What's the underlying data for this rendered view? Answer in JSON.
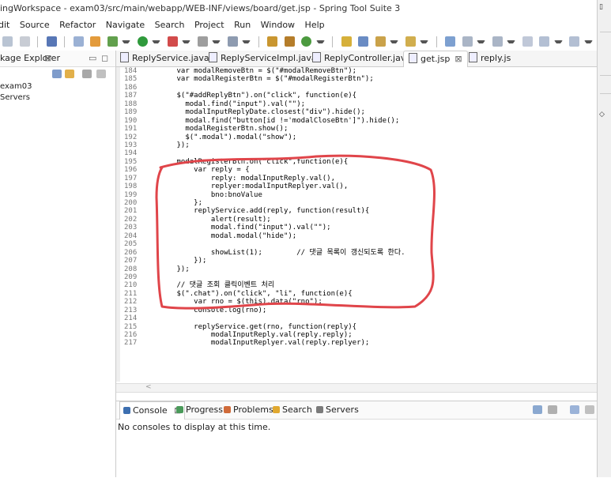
{
  "window": {
    "title": "ingWorkspace - exam03/src/main/webapp/WEB-INF/views/board/get.jsp - Spring Tool Suite 3"
  },
  "menu": [
    "dit",
    "Source",
    "Refactor",
    "Navigate",
    "Search",
    "Project",
    "Run",
    "Window",
    "Help"
  ],
  "package_explorer": {
    "title": "kage Explorer",
    "close_glyph": "⊠",
    "minimize_glyph": "▭",
    "maximize_glyph": "◻",
    "items": [
      "exam03",
      "Servers"
    ]
  },
  "editor": {
    "tabs": [
      {
        "label": "ReplyService.java",
        "active": false
      },
      {
        "label": "ReplyServiceImpl.java",
        "active": false
      },
      {
        "label": "ReplyController.java",
        "active": false
      },
      {
        "label": "get.jsp",
        "active": true,
        "close_glyph": "⊠"
      },
      {
        "label": "reply.js",
        "active": false
      }
    ],
    "lines": [
      {
        "n": "184",
        "t": "      var modalRemoveBtn = $(\"#modalRemoveBtn\");"
      },
      {
        "n": "185",
        "t": "      var modalRegisterBtn = $(\"#modalRegisterBtn\");"
      },
      {
        "n": "186",
        "t": ""
      },
      {
        "n": "187",
        "t": "      $(\"#addReplyBtn\").on(\"click\", function(e){"
      },
      {
        "n": "188",
        "t": "        modal.find(\"input\").val(\"\");"
      },
      {
        "n": "189",
        "t": "        modalInputReplyDate.closest(\"div\").hide();"
      },
      {
        "n": "190",
        "t": "        modal.find(\"button[id !='modalCloseBtn']\").hide();"
      },
      {
        "n": "191",
        "t": "        modalRegisterBtn.show();"
      },
      {
        "n": "192",
        "t": "        $(\".modal\").modal(\"show\");"
      },
      {
        "n": "193",
        "t": "      });"
      },
      {
        "n": "194",
        "t": ""
      },
      {
        "n": "195",
        "t": "      modalRegisterBtn.on(\"click\",function(e){"
      },
      {
        "n": "196",
        "t": "          var reply = {"
      },
      {
        "n": "197",
        "t": "              reply: modalInputReply.val(),"
      },
      {
        "n": "198",
        "t": "              replyer:modalInputReplyer.val(),"
      },
      {
        "n": "199",
        "t": "              bno:bnoValue"
      },
      {
        "n": "200",
        "t": "          };"
      },
      {
        "n": "201",
        "t": "          replyService.add(reply, function(result){"
      },
      {
        "n": "202",
        "t": "              alert(result);"
      },
      {
        "n": "203",
        "t": "              modal.find(\"input\").val(\"\");"
      },
      {
        "n": "204",
        "t": "              modal.modal(\"hide\");"
      },
      {
        "n": "205",
        "t": ""
      },
      {
        "n": "206",
        "t": "              showList(1);        // 댓글 목록이 갱신되도록 한다."
      },
      {
        "n": "207",
        "t": "          });"
      },
      {
        "n": "208",
        "t": "      });"
      },
      {
        "n": "209",
        "t": ""
      },
      {
        "n": "210",
        "t": "      // 댓글 조회 클릭이벤트 처리"
      },
      {
        "n": "211",
        "t": "      $(\".chat\").on(\"click\", \"li\", function(e){"
      },
      {
        "n": "212",
        "t": "          var rno = $(this).data(\"rno\");"
      },
      {
        "n": "213",
        "t": "          console.log(rno);"
      },
      {
        "n": "214",
        "t": ""
      },
      {
        "n": "215",
        "t": "          replyService.get(rno, function(reply){"
      },
      {
        "n": "216",
        "t": "              modalInputReply.val(reply.reply);"
      },
      {
        "n": "217",
        "t": "              modalInputReplyer.val(reply.replyer);"
      }
    ],
    "hscroll_arrow": "<"
  },
  "console": {
    "tabs": [
      "Console",
      "Progress",
      "Problems",
      "Search",
      "Servers"
    ],
    "console_close_glyph": "⊠",
    "message": "No consoles to display at this time."
  },
  "colors": {
    "annotation": "#e0454a",
    "keyword": "#7f0055",
    "string": "#2a00ff",
    "comment": "#3f7f5f"
  }
}
